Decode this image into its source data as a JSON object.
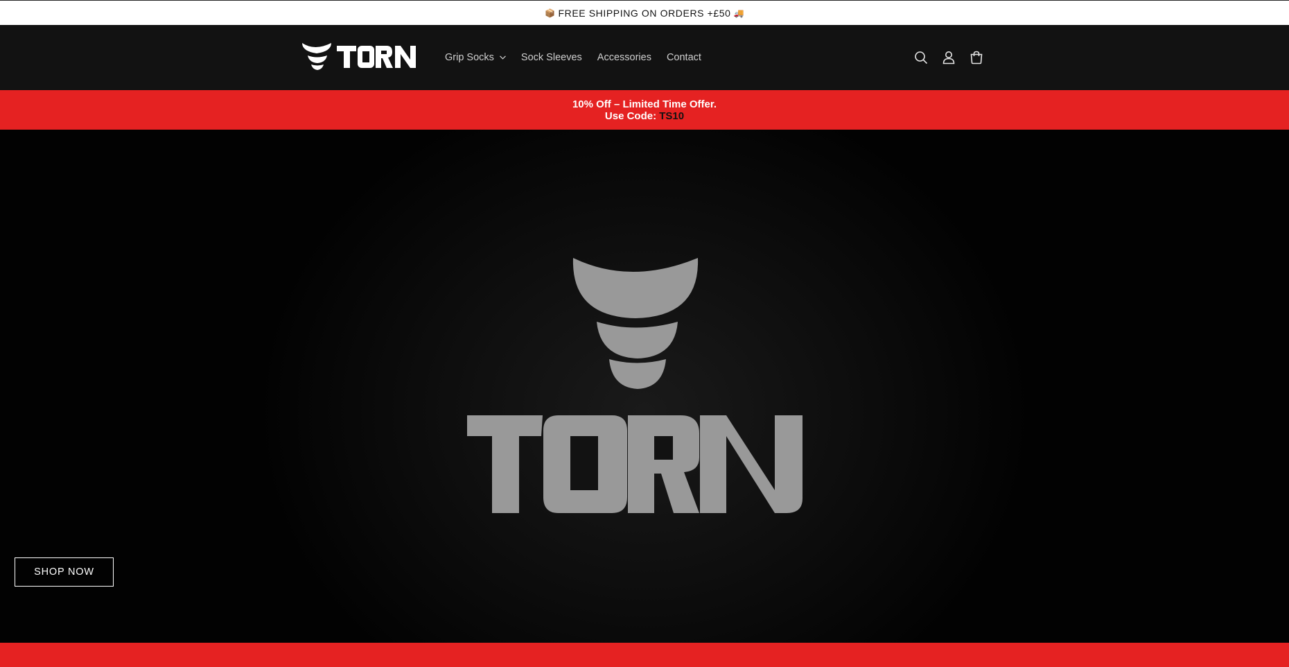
{
  "announcement": {
    "lead_emoji": "📦",
    "text": "FREE SHIPPING ON ORDERS +£50",
    "trail_emoji": "🚚"
  },
  "header": {
    "logo_text": "TORN",
    "nav": [
      {
        "label": "Grip Socks",
        "has_dropdown": true
      },
      {
        "label": "Sock Sleeves",
        "has_dropdown": false
      },
      {
        "label": "Accessories",
        "has_dropdown": false
      },
      {
        "label": "Contact",
        "has_dropdown": false
      }
    ],
    "icons": [
      "search-icon",
      "account-icon",
      "cart-icon"
    ]
  },
  "promo": {
    "line1": "10% Off – Limited Time Offer.",
    "line2_prefix": "Use Code: ",
    "code": "TS10"
  },
  "hero": {
    "logo_text": "TORN",
    "button_label": "SHOP NOW"
  },
  "colors": {
    "brand_red": "#e52222",
    "header_bg": "#121212",
    "hero_logo_gray": "#999999"
  }
}
